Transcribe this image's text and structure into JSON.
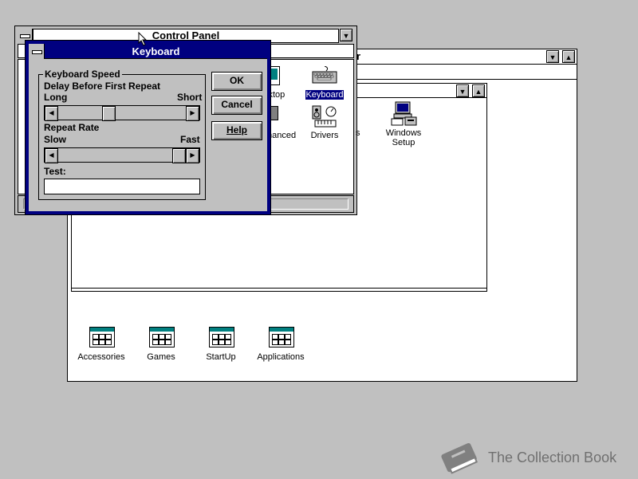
{
  "program_manager": {
    "title_fragment": "r"
  },
  "group_window": {
    "groups": [
      {
        "label": "Accessories"
      },
      {
        "label": "Games"
      },
      {
        "label": "StartUp"
      },
      {
        "label": "Applications"
      }
    ]
  },
  "control_panel": {
    "title": "Control Panel",
    "icons": [
      {
        "label": "sktop"
      },
      {
        "label": "Keyboard"
      },
      {
        "label": "nanced"
      },
      {
        "label": "Drivers"
      },
      {
        "label": "s"
      },
      {
        "label": "Windows Setup"
      }
    ]
  },
  "keyboard_dialog": {
    "title": "Keyboard",
    "group_title": "Keyboard Speed",
    "delay_label": "Delay Before First Repeat",
    "delay_min": "Long",
    "delay_max": "Short",
    "delay_value": 0.38,
    "repeat_label": "Repeat Rate",
    "repeat_min": "Slow",
    "repeat_max": "Fast",
    "repeat_value": 0.97,
    "test_label": "Test:",
    "test_value": "",
    "ok_label": "OK",
    "cancel_label": "Cancel",
    "help_label": "Help"
  },
  "watermark": {
    "text": "The Collection Book"
  },
  "colors": {
    "desktop": "#c0c0c0",
    "active_title": "#000080",
    "selection": "#000080"
  }
}
